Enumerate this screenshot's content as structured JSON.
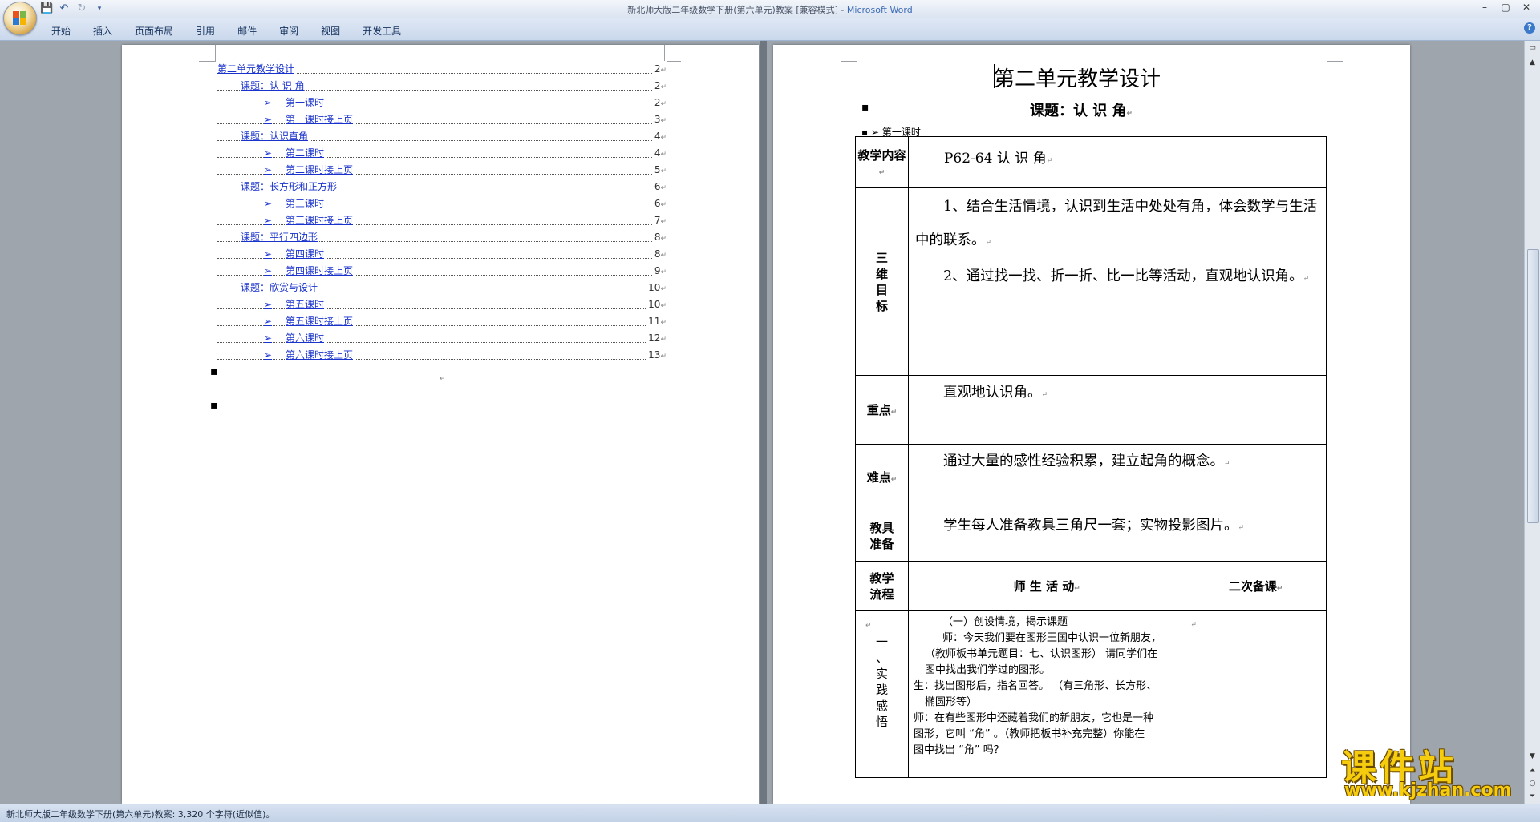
{
  "window": {
    "title_doc": "新北师大版二年级数学下册(第六单元)教案 [兼容模式] - ",
    "title_app": "Microsoft Word",
    "controls": [
      "–",
      "▢",
      "✕"
    ]
  },
  "ribbon": {
    "tabs": [
      "开始",
      "插入",
      "页面布局",
      "引用",
      "邮件",
      "审阅",
      "视图",
      "开发工具"
    ],
    "help": "?"
  },
  "toc": [
    {
      "text": "第二单元教学设计",
      "page": "2",
      "level": 0
    },
    {
      "text": "课题：认 识 角",
      "page": "2",
      "level": 1
    },
    {
      "text": "第一课时",
      "page": "2",
      "level": 2
    },
    {
      "text": "第一课时接上页",
      "page": "3",
      "level": 2
    },
    {
      "text": "课题：认识直角",
      "page": "4",
      "level": 1
    },
    {
      "text": "第二课时",
      "page": "4",
      "level": 2
    },
    {
      "text": "第二课时接上页",
      "page": "5",
      "level": 2
    },
    {
      "text": "课题：长方形和正方形",
      "page": "6",
      "level": 1
    },
    {
      "text": "第三课时",
      "page": "6",
      "level": 2
    },
    {
      "text": "第三课时接上页",
      "page": "7",
      "level": 2
    },
    {
      "text": "课题：平行四边形",
      "page": "8",
      "level": 1
    },
    {
      "text": "第四课时",
      "page": "8",
      "level": 2
    },
    {
      "text": "第四课时接上页",
      "page": "9",
      "level": 2
    },
    {
      "text": "课题：欣赏与设计",
      "page": "10",
      "level": 1
    },
    {
      "text": "第五课时",
      "page": "10",
      "level": 2
    },
    {
      "text": "第五课时接上页",
      "page": "11",
      "level": 2
    },
    {
      "text": "第六课时",
      "page": "12",
      "level": 2
    },
    {
      "text": "第六课时接上页",
      "page": "13",
      "level": 2
    }
  ],
  "doc": {
    "title": "第二单元教学设计",
    "subtitle": "课题：认 识 角",
    "lesson_label": "▪ ➢  第一课时",
    "table": {
      "r1_head": "教学内容",
      "r1_body": "P62-64 认 识 角",
      "r2_head": "三维目标",
      "r2_p1": "1、结合生活情境，认识到生活中处处有角，体会数学与生活中的联系。",
      "r2_p2": "2、通过找一找、折一折、比一比等活动，直观地认识角。",
      "r3_head": "重点",
      "r3_body": "直观地认识角。",
      "r4_head": "难点",
      "r4_body": "通过大量的感性经验积累，建立起角的概念。",
      "r5_head": "教具准备",
      "r5_body": "学生每人准备教具三角尺一套；实物投影图片。",
      "r6_head": "教学流程",
      "r6_mid": "师  生  活  动",
      "r6_right": "二次备课",
      "r7_head": "一、实践感悟",
      "r7_lines": [
        "（一）创设情境，揭示课题",
        "师：今天我们要在图形王国中认识一位新朋友，",
        "（教师板书单元题目：七、认识图形） 请同学们在",
        "图中找出我们学过的图形。",
        "生：找出图形后，指名回答。    （有三角形、长方形、",
        "椭圆形等）",
        "师：在有些图形中还藏着我们的新朋友，它也是一种",
        "图形，它叫 “角” 。（教师把板书补充完整）你能在",
        "图中找出 “角” 吗？"
      ]
    }
  },
  "status": {
    "text": "新北师大版二年级数学下册(第六单元)教案: 3,320 个字符(近似值)。"
  },
  "watermark": {
    "cn": "课件站",
    "url": "www.kjzhan.com"
  }
}
